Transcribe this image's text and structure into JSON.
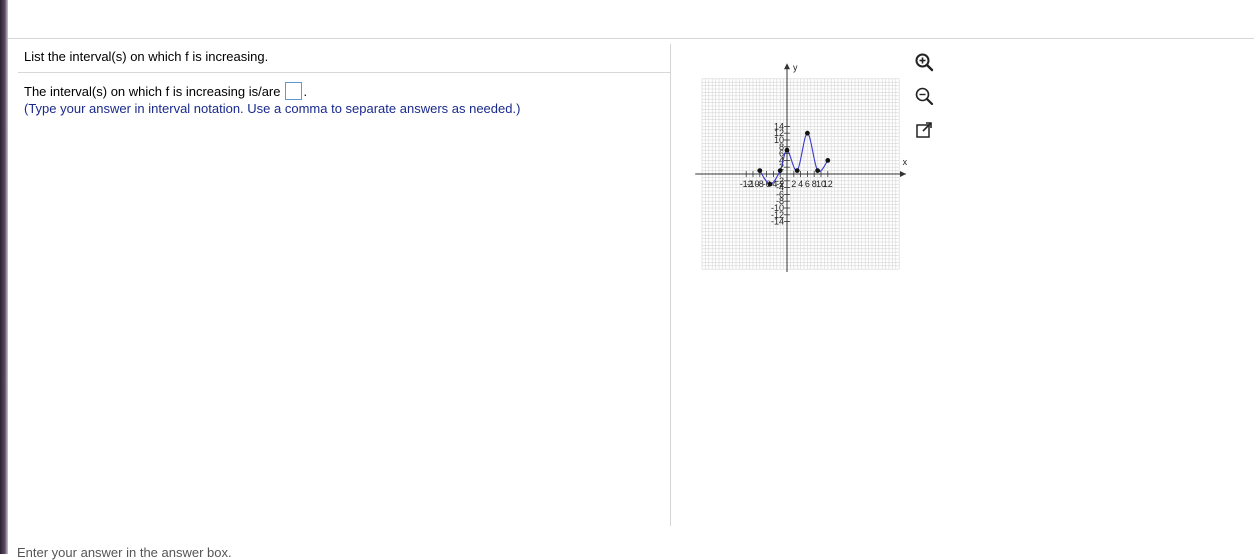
{
  "question": {
    "prompt": "List the interval(s) on which f is increasing.",
    "answer_prefix": "The interval(s) on which f is increasing is/are",
    "answer_value": "",
    "answer_suffix": ".",
    "hint": "(Type your answer in interval notation. Use a comma to separate answers as needed.)"
  },
  "footer": {
    "text": "Enter your answer in the answer box."
  },
  "toolbar": {
    "zoom_in_icon": "zoom-in-icon",
    "zoom_out_icon": "zoom-out-icon",
    "popout_icon": "popout-icon"
  },
  "colors": {
    "curve": "#3a3ad0",
    "grid": "#d6d6d6",
    "hint": "#1a2a8c",
    "input_border": "#5b9bd5"
  },
  "chart_data": {
    "type": "line",
    "title": "",
    "xlabel": "x",
    "ylabel": "y",
    "xlim": [
      -14,
      14
    ],
    "ylim": [
      -14,
      14
    ],
    "grid": true,
    "x_ticks": [
      "-12",
      "-10",
      "-8",
      "-6",
      "-4",
      "-2",
      "2",
      "4",
      "6",
      "8",
      "10",
      "12"
    ],
    "y_ticks": [
      "14",
      "12",
      "10",
      "8",
      "6",
      "4",
      "2",
      "-2",
      "-4",
      "-6",
      "-8",
      "-10",
      "-12",
      "-14"
    ],
    "points": [
      {
        "x": -8,
        "y": 1
      },
      {
        "x": -5,
        "y": -3
      },
      {
        "x": -2,
        "y": 1
      },
      {
        "x": 0,
        "y": 7
      },
      {
        "x": 3,
        "y": 1
      },
      {
        "x": 6,
        "y": 12
      },
      {
        "x": 9,
        "y": 1
      },
      {
        "x": 12,
        "y": 4
      }
    ]
  }
}
